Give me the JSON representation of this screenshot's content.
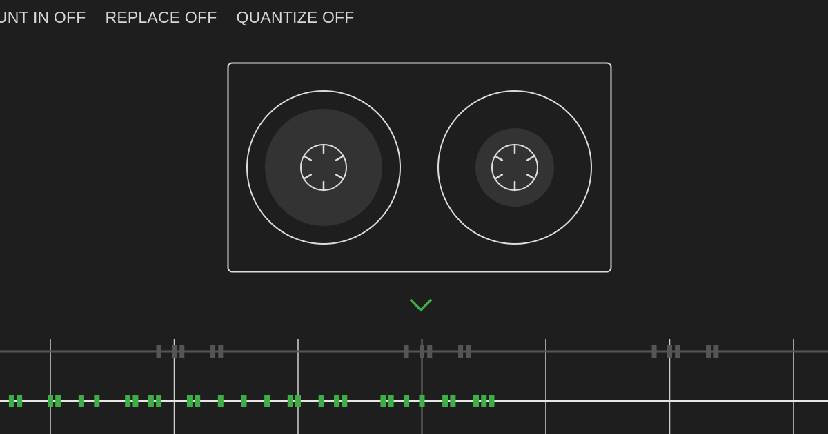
{
  "toolbar": {
    "items": [
      {
        "label": "COUNT IN OFF"
      },
      {
        "label": "REPLACE OFF"
      },
      {
        "label": "QUANTIZE OFF"
      }
    ]
  },
  "icons": {
    "collapse": "chevron-down-icon",
    "cassette": "cassette-tape-icon"
  },
  "colors": {
    "background": "#1e1e1e",
    "text": "#d8d8d8",
    "accent_green": "#3fae49",
    "muted_gray": "#555555",
    "line_white": "#e6e6e6"
  },
  "timeline": {
    "bars": 7,
    "ghost_note_pattern_steps": [
      3.5,
      4,
      4.25,
      5.25,
      5.5
    ],
    "recorded_note_steps": [
      0,
      0.75,
      1,
      2,
      2.25,
      3,
      3.5,
      4.5,
      4.75,
      5.25,
      5.5,
      6.5,
      6.75,
      7.5,
      8.25,
      9,
      9.75,
      10,
      10.75,
      11.25,
      11.5,
      12.75,
      13,
      13.5,
      14,
      14.75,
      15,
      15.75,
      16,
      16.25
    ]
  }
}
